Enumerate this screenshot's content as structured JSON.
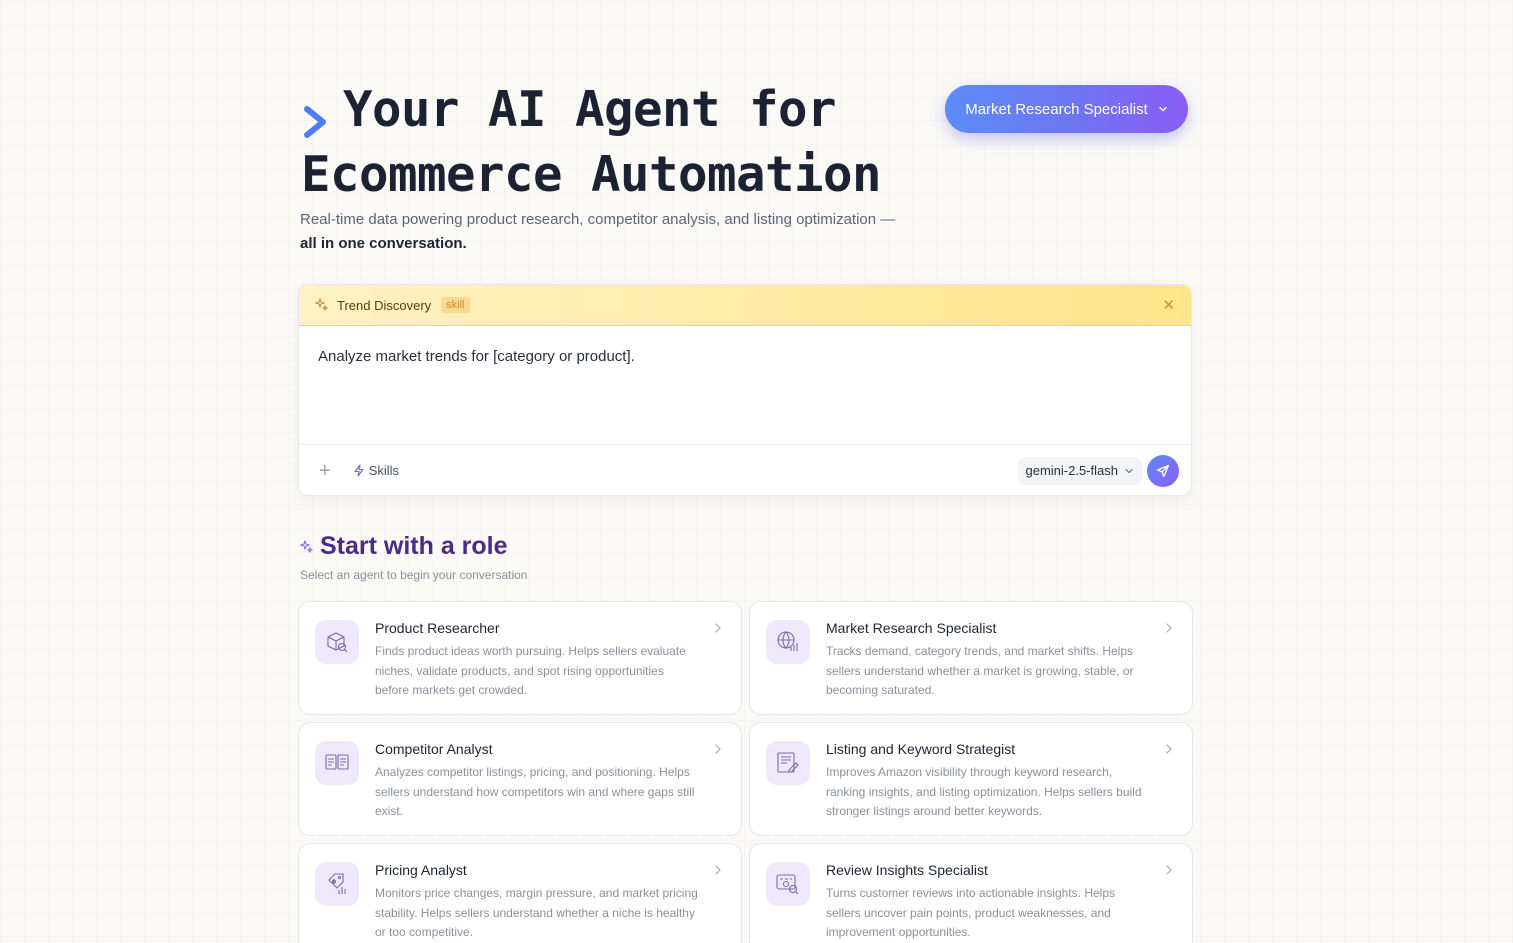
{
  "hero": {
    "title": "Your AI Agent for Ecommerce Automation",
    "subtitle": "Real-time data powering product research, competitor analysis, and listing optimization —",
    "subtitle_bold": "all in one conversation."
  },
  "role_selector": {
    "label": "Market Research Specialist"
  },
  "composer": {
    "skill_name": "Trend Discovery",
    "skill_tag": "skill",
    "prompt": "Analyze market trends for [category or product].",
    "skills_label": "Skills",
    "model": "gemini-2.5-flash"
  },
  "roles": {
    "title": "Start with a role",
    "subtitle": "Select an agent to begin your conversation",
    "items": [
      {
        "title": "Product Researcher",
        "desc": "Finds product ideas worth pursuing. Helps sellers evaluate niches, validate products, and spot rising opportunities before markets get crowded.",
        "icon": "package-search-icon"
      },
      {
        "title": "Market Research Specialist",
        "desc": "Tracks demand, category trends, and market shifts. Helps sellers understand whether a market is growing, stable, or becoming saturated.",
        "icon": "globe-chart-icon"
      },
      {
        "title": "Competitor Analyst",
        "desc": "Analyzes competitor listings, pricing, and positioning. Helps sellers understand how competitors win and where gaps still exist.",
        "icon": "compare-cards-icon"
      },
      {
        "title": "Listing and Keyword Strategist",
        "desc": "Improves Amazon visibility through keyword research, ranking insights, and listing optimization. Helps sellers build stronger listings around better keywords.",
        "icon": "document-edit-icon"
      },
      {
        "title": "Pricing Analyst",
        "desc": "Monitors price changes, margin pressure, and market pricing stability. Helps sellers understand whether a niche is healthy or too competitive.",
        "icon": "price-tag-icon"
      },
      {
        "title": "Review Insights Specialist",
        "desc": "Turns customer reviews into actionable insights. Helps sellers uncover pain points, product weaknesses, and improvement opportunities.",
        "icon": "review-search-icon"
      }
    ]
  }
}
